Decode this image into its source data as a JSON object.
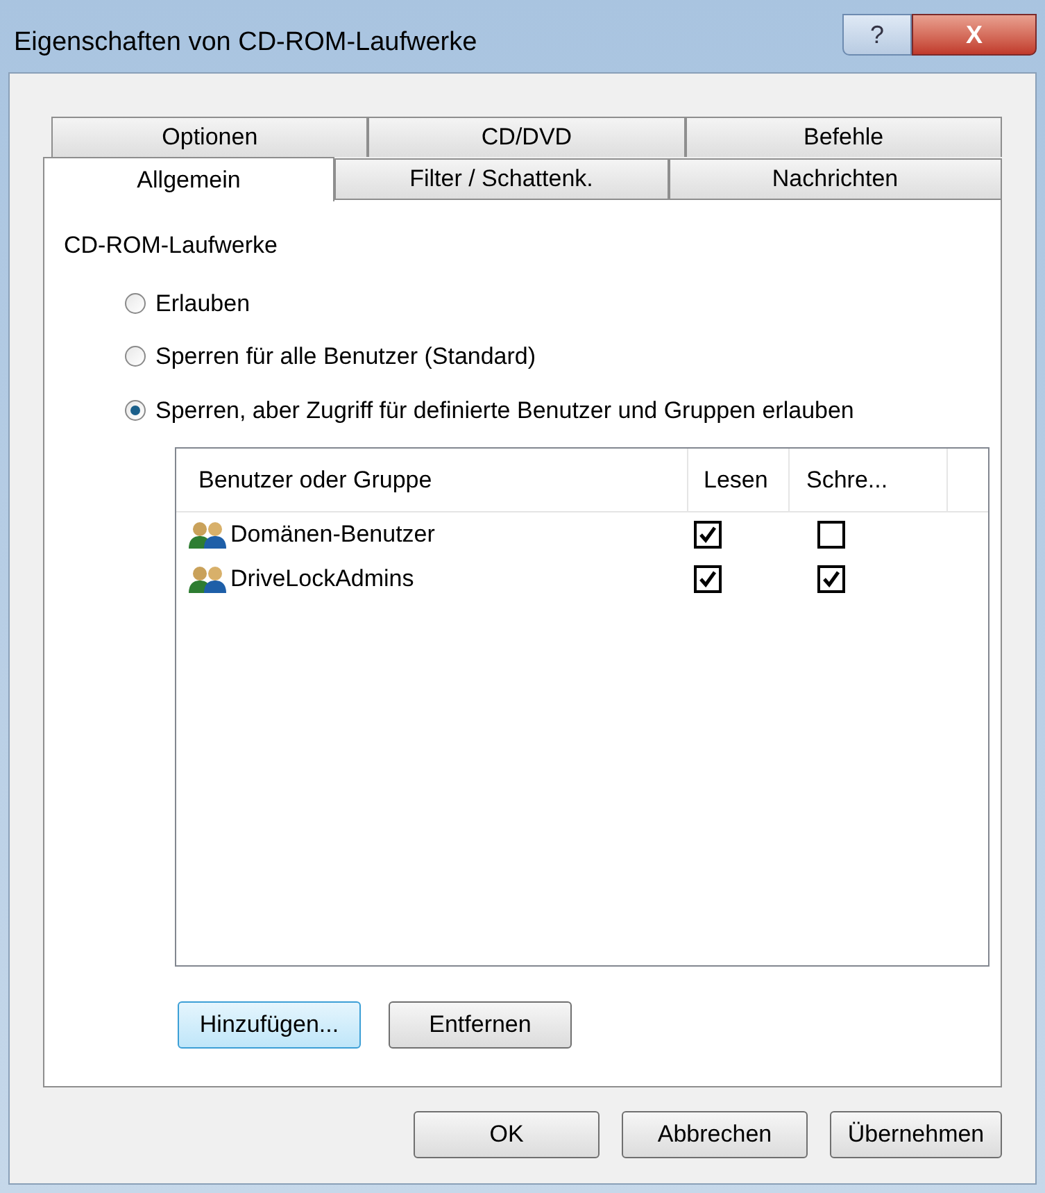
{
  "window": {
    "title": "Eigenschaften von CD-ROM-Laufwerke",
    "help_button": "?",
    "close_button": "X"
  },
  "tab_rows": [
    [
      {
        "label": "Optionen",
        "selected": false
      },
      {
        "label": "CD/DVD",
        "selected": false
      },
      {
        "label": "Befehle",
        "selected": false
      }
    ],
    [
      {
        "label": "Allgemein",
        "selected": true
      },
      {
        "label": "Filter / Schattenk.",
        "selected": false
      },
      {
        "label": "Nachrichten",
        "selected": false
      }
    ]
  ],
  "group_label": "CD-ROM-Laufwerke",
  "options": [
    {
      "label": "Erlauben",
      "selected": false
    },
    {
      "label": "Sperren für alle Benutzer (Standard)",
      "selected": false
    },
    {
      "label": "Sperren, aber Zugriff für definierte Benutzer und Gruppen erlauben",
      "selected": true
    }
  ],
  "table": {
    "columns": [
      "Benutzer oder Gruppe",
      "Lesen",
      "Schre..."
    ],
    "rows": [
      {
        "name": "Domänen-Benutzer",
        "read": true,
        "write": false
      },
      {
        "name": "DriveLockAdmins",
        "read": true,
        "write": true
      }
    ]
  },
  "list_buttons": [
    {
      "label": "Hinzufügen...",
      "focused": true
    },
    {
      "label": "Entfernen",
      "focused": false
    }
  ],
  "buttons": [
    "OK",
    "Abbrechen",
    "Übernehmen"
  ]
}
